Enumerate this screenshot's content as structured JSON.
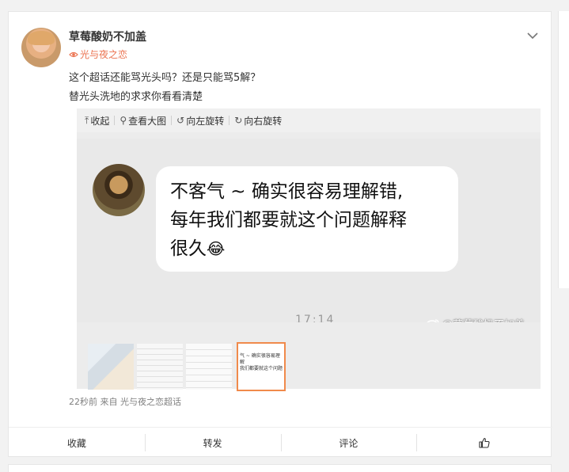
{
  "post": {
    "username": "草莓酸奶不加盖",
    "topic": "光与夜之恋",
    "text_line_1": "这个超话还能骂光头吗？还是只能骂5解？",
    "text_line_2": "替光头洗地的求求你看看清楚",
    "meta": "22秒前  来自 光与夜之恋超话"
  },
  "viewer": {
    "toolbar": {
      "collapse": "收起",
      "view_large": "查看大图",
      "rotate_left": "向左旋转",
      "rotate_right": "向右旋转"
    },
    "bubble": {
      "line1": "不客气 ~ 确实很容易理解错,",
      "line2": "每年我们都要就这个问题解释",
      "line3": "很久",
      "emoji": "😂"
    },
    "time_peek": "17:14",
    "watermark": "@草莓酸奶不加盖",
    "thumb_text": "气 ~ 确实很容易理解\n我们都要就这个问题"
  },
  "actions": {
    "collect": "收藏",
    "repost": "转发",
    "comment": "评论",
    "like": ""
  },
  "colors": {
    "accent": "#eb7350",
    "thumb_selected": "#f08a4b"
  }
}
